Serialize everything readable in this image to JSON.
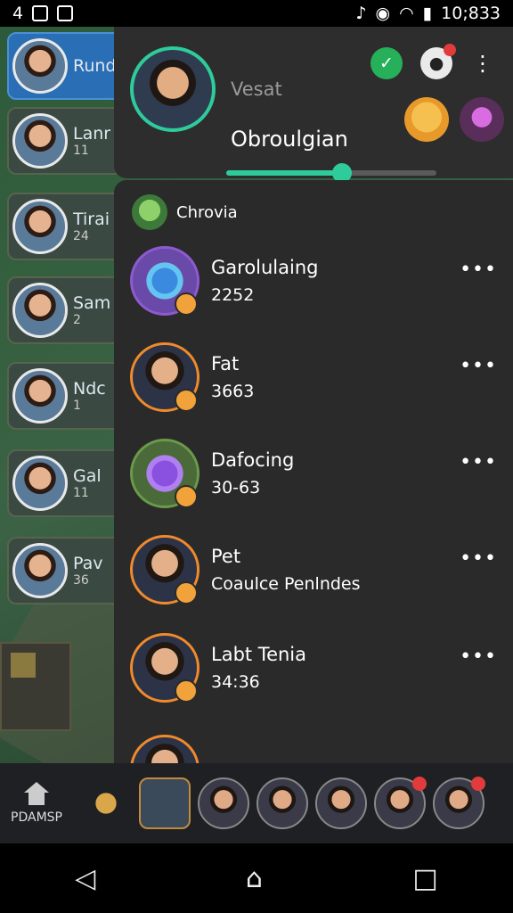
{
  "status_bar": {
    "left_number": "4",
    "time": "10;833"
  },
  "sidebar": {
    "items": [
      {
        "name": "Rundy",
        "sub": ""
      },
      {
        "name": "Lanr",
        "sub": "11"
      },
      {
        "name": "Tirai",
        "sub": "24"
      },
      {
        "name": "Sam",
        "sub": "2"
      },
      {
        "name": "Ndc",
        "sub": "1"
      },
      {
        "name": "Gal",
        "sub": "11"
      },
      {
        "name": "Pav",
        "sub": "36"
      }
    ]
  },
  "profile": {
    "label": "Vesat",
    "name": "Obroulgian",
    "level": 0.55
  },
  "list": {
    "section_title": "Chrovia",
    "items": [
      {
        "title": "Garolulaing",
        "sub": "2252"
      },
      {
        "title": "Fat",
        "sub": "3663"
      },
      {
        "title": "Dafocing",
        "sub": "30-63"
      },
      {
        "title": "Pet",
        "sub": "Coaulce Penlndes"
      },
      {
        "title": "Labt Tenia",
        "sub": "34:36"
      }
    ],
    "more_glyph": "•••"
  },
  "dock": {
    "home_label": "PDAMSP"
  },
  "colors": {
    "accent": "#2ecc9a",
    "panel": "#2a2a2a"
  }
}
